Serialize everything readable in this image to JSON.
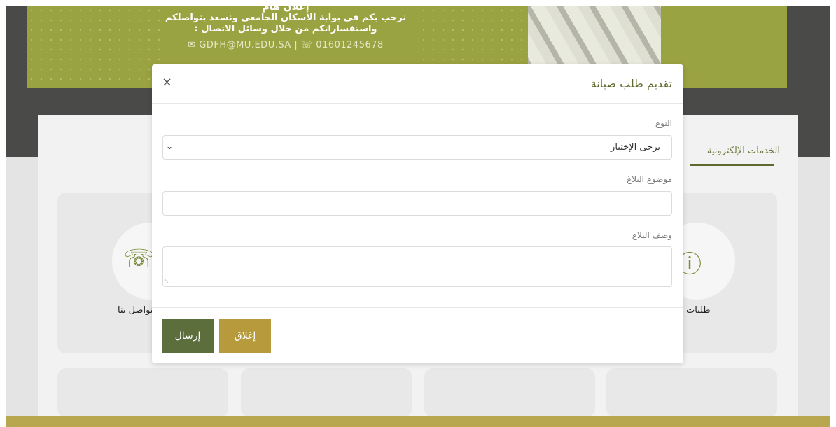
{
  "banner": {
    "heading": "إعلان هام",
    "line1": "نرحب بكم في بوابة الاسكان الجامعي ونسعد بتواصلكم",
    "line2": "واستفساراتكم من خلال وسائل الاتصال :",
    "email": "GDFH@MU.EDU.SA",
    "phone": "01601245678"
  },
  "services": {
    "title": "الخدمات الإلكترونية",
    "cards": [
      {
        "label": "تواصل بنا",
        "icon": "phone-icon"
      },
      {
        "label": "طلبات",
        "icon": "info-icon"
      }
    ]
  },
  "modal": {
    "title": "تقديم طلب صيانة",
    "close_symbol": "×",
    "type_label": "النوع",
    "type_value": "يرجى الإختيار",
    "subject_label": "موضوع البلاغ",
    "subject_value": "",
    "description_label": "وصف البلاغ",
    "description_value": "",
    "submit_label": "إرسال",
    "close_label": "إغلاق"
  },
  "colors": {
    "accent_olive": "#5d6e3d",
    "accent_gold": "#b69a3c",
    "banner_green": "#9aa341"
  }
}
